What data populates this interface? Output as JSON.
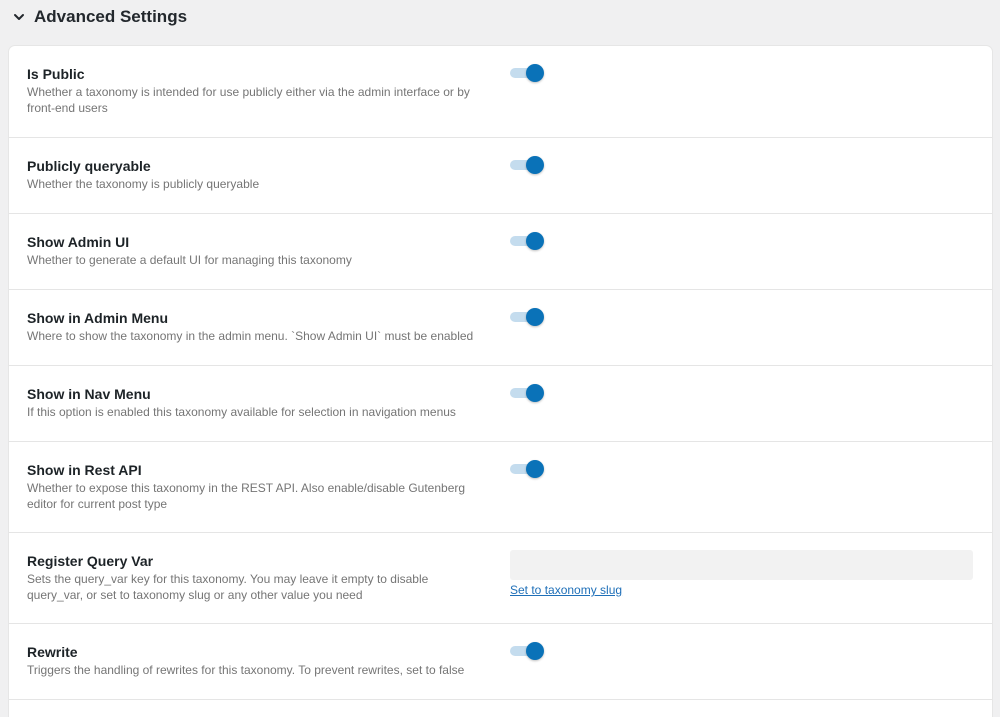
{
  "section": {
    "title": "Advanced Settings",
    "icon": "chevron-down-icon"
  },
  "colors": {
    "toggle_on_knob": "#0a72b8",
    "toggle_on_track": "#c4dcee",
    "link": "#1e6fb8"
  },
  "settings": [
    {
      "label": "Is Public",
      "description": "Whether a taxonomy is intended for use publicly either via the admin interface or by front-end users",
      "enabled": true
    },
    {
      "label": "Publicly queryable",
      "description": "Whether the taxonomy is publicly queryable",
      "enabled": true
    },
    {
      "label": "Show Admin UI",
      "description": "Whether to generate a default UI for managing this taxonomy",
      "enabled": true
    },
    {
      "label": "Show in Admin Menu",
      "description": "Where to show the taxonomy in the admin menu. `Show Admin UI` must be enabled",
      "enabled": true
    },
    {
      "label": "Show in Nav Menu",
      "description": "If this option is enabled this taxonomy available for selection in navigation menus",
      "enabled": true
    },
    {
      "label": "Show in Rest API",
      "description": "Whether to expose this taxonomy in the REST API. Also enable/disable Gutenberg editor for current post type",
      "enabled": true
    },
    {
      "label": "Register Query Var",
      "description": "Sets the query_var key for this taxonomy. You may leave it empty to disable query_var, or set to taxonomy slug or any other value you need",
      "value": "",
      "placeholder": "",
      "link_text": "Set to taxonomy slug"
    },
    {
      "label": "Rewrite",
      "description": "Triggers the handling of rewrites for this taxonomy. To prevent rewrites, set to false",
      "enabled": true
    }
  ]
}
